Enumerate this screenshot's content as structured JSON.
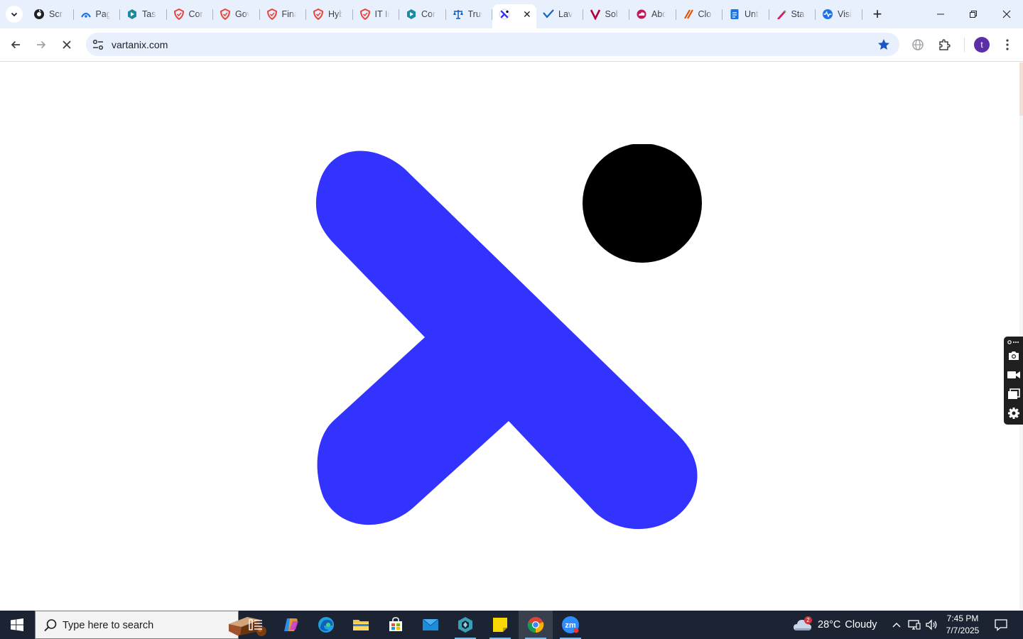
{
  "browser": {
    "tabs": [
      {
        "title": "Scr",
        "icon": "scrutiny-icon",
        "color": "#202124"
      },
      {
        "title": "Pag",
        "icon": "pagerduty-icon",
        "color": "#1a73e8"
      },
      {
        "title": "Tasl",
        "icon": "task-hexagon-icon",
        "color": "#1a8ca0"
      },
      {
        "title": "Cor",
        "icon": "drata-shield-icon",
        "color": "#e8453c"
      },
      {
        "title": "Gov",
        "icon": "drata-shield-icon",
        "color": "#e8453c"
      },
      {
        "title": "Fina",
        "icon": "drata-shield-icon",
        "color": "#e8453c"
      },
      {
        "title": "Hyb",
        "icon": "drata-shield-icon",
        "color": "#e8453c"
      },
      {
        "title": "IT Ir",
        "icon": "drata-shield-icon",
        "color": "#e8453c"
      },
      {
        "title": "Cor",
        "icon": "hexagon-icon",
        "color": "#1a8ca0"
      },
      {
        "title": "Trus",
        "icon": "scales-icon",
        "color": "#1565c0"
      },
      {
        "title": "",
        "icon": "vartanix-icon",
        "color": "#3333ff",
        "active": true,
        "close": "✕"
      },
      {
        "title": "Lav",
        "icon": "checkmark-icon",
        "color": "#1565c0"
      },
      {
        "title": "Sol",
        "icon": "v-logo-icon",
        "color": "#b0003a"
      },
      {
        "title": "Abc",
        "icon": "cloud-icon",
        "color": "#c2185b"
      },
      {
        "title": "Clo",
        "icon": "slash-icon",
        "color": "#e65100"
      },
      {
        "title": "Unt",
        "icon": "docs-icon",
        "color": "#1a73e8"
      },
      {
        "title": "Sta",
        "icon": "pen-icon",
        "color": "#d81b60"
      },
      {
        "title": "Visi",
        "icon": "pulse-icon",
        "color": "#1a73e8"
      }
    ],
    "new_tab": "+",
    "url": "vartanix.com",
    "bookmarked": true,
    "profile_initial": "t"
  },
  "page": {
    "logo": {
      "icon": "vartanix-logo",
      "colors": {
        "stroke": "#3333ff",
        "dot": "#000000"
      }
    }
  },
  "taskbar": {
    "search_placeholder": "Type here to search",
    "weather": {
      "temp": "28°C",
      "condition": "Cloudy",
      "badge": "2"
    },
    "time": "7:45 PM",
    "date": "7/7/2025",
    "apps": [
      "task-view-icon",
      "copilot-icon",
      "edge-icon",
      "file-explorer-icon",
      "store-icon",
      "mail-icon",
      "app-hexagon-icon",
      "sticky-notes-icon",
      "chrome-icon",
      "zoom-icon"
    ]
  },
  "colors": {
    "tabstrip_bg": "#e8f0fe",
    "taskbar_bg": "#1c2433",
    "accent": "#1a73e8"
  }
}
